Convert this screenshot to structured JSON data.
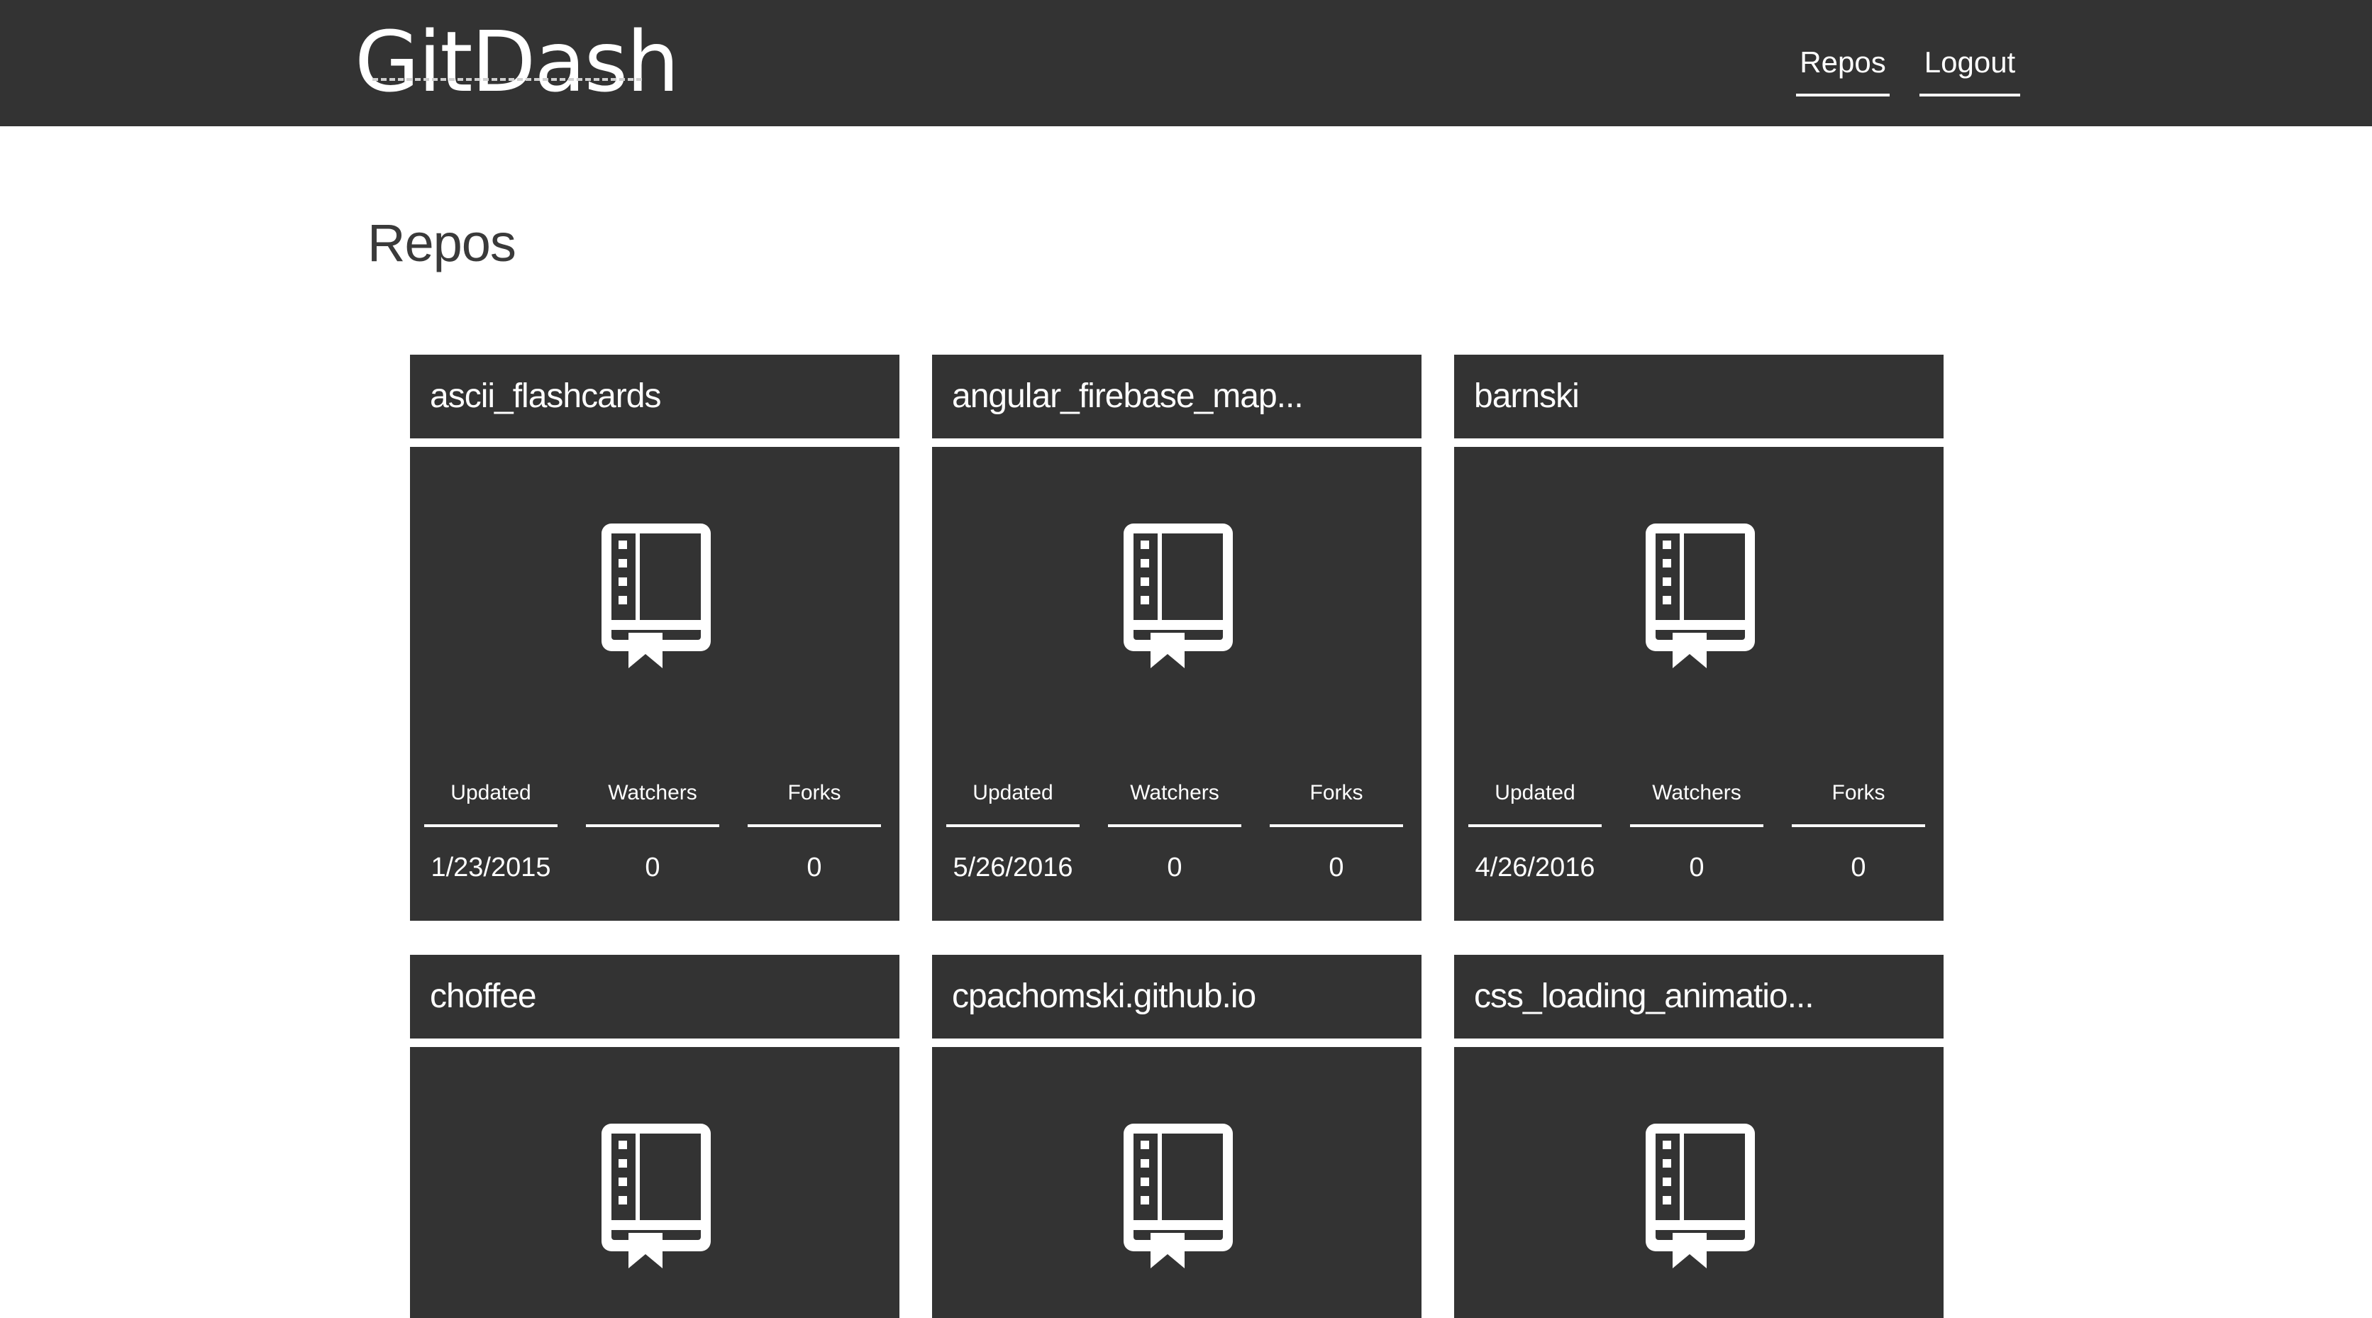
{
  "header": {
    "logo": "GitDash",
    "nav": [
      {
        "label": "Repos"
      },
      {
        "label": "Logout"
      }
    ]
  },
  "page": {
    "title": "Repos"
  },
  "stat_labels": {
    "updated": "Updated",
    "watchers": "Watchers",
    "forks": "Forks"
  },
  "icons": {
    "repo": "repo-book-icon"
  },
  "colors": {
    "dark": "#333333",
    "text_light": "#ffffff",
    "background": "#ffffff"
  },
  "repos": [
    {
      "name": "ascii_flashcards",
      "updated": "1/23/2015",
      "watchers": "0",
      "forks": "0"
    },
    {
      "name": "angular_firebase_map...",
      "updated": "5/26/2016",
      "watchers": "0",
      "forks": "0"
    },
    {
      "name": "barnski",
      "updated": "4/26/2016",
      "watchers": "0",
      "forks": "0"
    },
    {
      "name": "choffee"
    },
    {
      "name": "cpachomski.github.io"
    },
    {
      "name": "css_loading_animatio..."
    }
  ]
}
